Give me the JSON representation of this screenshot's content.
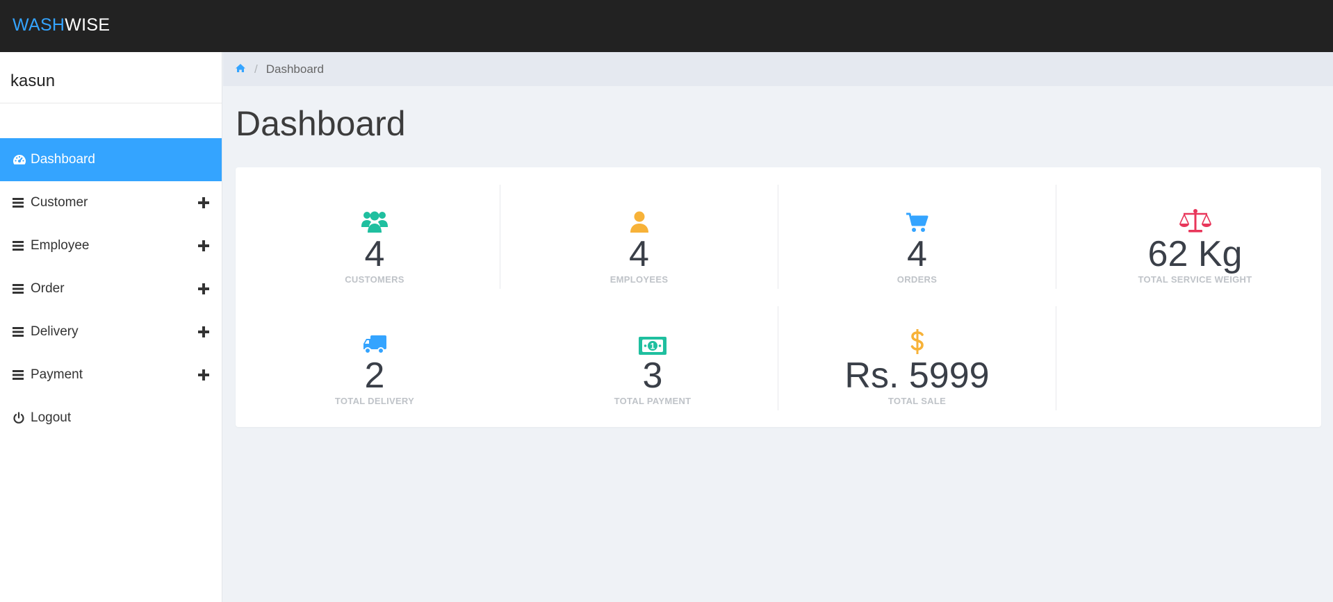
{
  "brand": {
    "part1": "WASH",
    "part2": "WISE"
  },
  "sidebar": {
    "user": "kasun",
    "items": [
      {
        "label": "Dashboard",
        "icon": "dashboard-icon",
        "active": true
      },
      {
        "label": "Customer",
        "icon": "menu-icon"
      },
      {
        "label": "Employee",
        "icon": "menu-icon"
      },
      {
        "label": "Order",
        "icon": "menu-icon"
      },
      {
        "label": "Delivery",
        "icon": "menu-icon"
      },
      {
        "label": "Payment",
        "icon": "menu-icon"
      },
      {
        "label": "Logout",
        "icon": "power-icon"
      }
    ]
  },
  "breadcrumb": {
    "home_icon": "home-icon",
    "current": "Dashboard"
  },
  "page": {
    "title": "Dashboard"
  },
  "stats": [
    {
      "value": "4",
      "label": "CUSTOMERS",
      "icon": "users-icon",
      "color": "#1fbf9f"
    },
    {
      "value": "4",
      "label": "EMPLOYEES",
      "icon": "user-icon",
      "color": "#f7b238"
    },
    {
      "value": "4",
      "label": "ORDERS",
      "icon": "cart-icon",
      "color": "#34a4ff"
    },
    {
      "value": "62 Kg",
      "label": "TOTAL SERVICE WEIGHT",
      "icon": "scale-icon",
      "color": "#e8365a"
    },
    {
      "value": "2",
      "label": "TOTAL DELIVERY",
      "icon": "truck-icon",
      "color": "#34a4ff"
    },
    {
      "value": "3",
      "label": "TOTAL PAYMENT",
      "icon": "money-icon",
      "color": "#1fbf9f"
    },
    {
      "value": "Rs. 5999",
      "label": "TOTAL SALE",
      "icon": "dollar-icon",
      "color": "#f7b238"
    }
  ],
  "colors": {
    "topbar": "#222222",
    "accent": "#34a4ff",
    "background": "#eff2f6"
  }
}
